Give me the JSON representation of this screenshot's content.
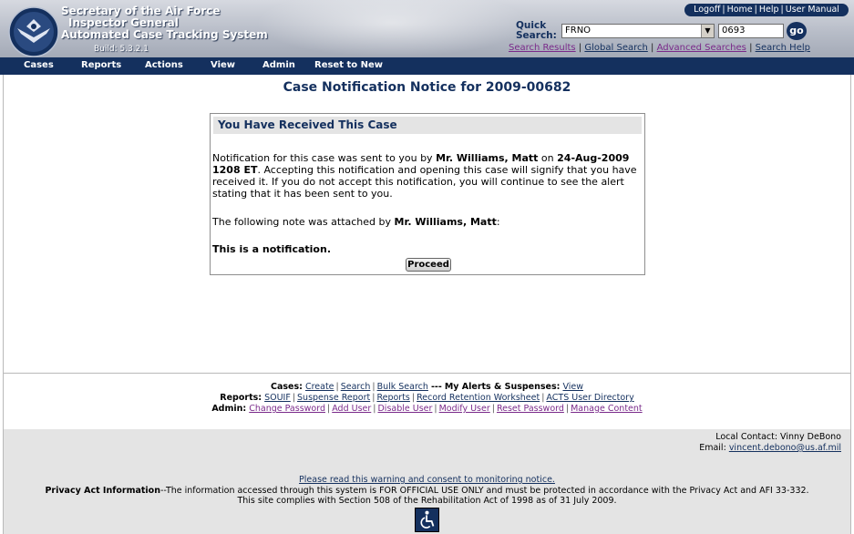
{
  "header": {
    "org_line1": "Secretary of the Air Force",
    "org_line2": "Inspector General",
    "org_line3": "Automated Case Tracking System",
    "build": "Build: 5.3.2.1",
    "top_links": [
      "Logoff",
      "Home",
      "Help",
      "User Manual"
    ],
    "quick_search": {
      "label_line1": "Quick",
      "label_line2": "Search:",
      "selected_type": "FRNO",
      "value": "0693",
      "go_label": "go"
    },
    "search_links": [
      "Search Results",
      "Global Search",
      "Advanced Searches",
      "Search Help"
    ]
  },
  "nav": [
    "Cases",
    "Reports",
    "Actions",
    "View",
    "Admin",
    "Reset to New"
  ],
  "page_title": "Case Notification Notice for 2009-00682",
  "notice": {
    "heading": "You Have Received This Case",
    "p1_prefix": "Notification for this case was sent to you by ",
    "sender": "Mr. Williams, Matt",
    "p1_on": " on ",
    "date": "24-Aug-2009 1208 ET",
    "p1_suffix": ". Accepting this notification and opening this case will signify that you have received it. If you do not accept this notification, you will continue to see the alert stating that it has been sent to you.",
    "note_prefix": "The following note was attached by ",
    "note_sender": "Mr. Williams, Matt",
    "note_suffix": ":",
    "note_text": "This is a notification.",
    "proceed_label": "Proceed"
  },
  "footer": {
    "cases_label": "Cases:",
    "cases_links": [
      "Create",
      "Search",
      "Bulk Search"
    ],
    "alerts_sep": "---",
    "alerts_label": "My Alerts & Suspenses:",
    "alerts_link": "View",
    "reports_label": "Reports:",
    "reports_links": [
      "SOUIF",
      "Suspense Report",
      "Reports",
      "Record Retention Worksheet",
      "ACTS User Directory"
    ],
    "admin_label": "Admin:",
    "admin_links": [
      "Change Password",
      "Add User",
      "Disable User",
      "Modify User",
      "Reset Password",
      "Manage Content"
    ]
  },
  "contact": {
    "local_contact": "Local Contact: Vinny DeBono",
    "email_label": "Email:",
    "email": "vincent.debono@us.af.mil"
  },
  "warning_link": "Please read this warning and consent to monitoring notice.",
  "privacy": {
    "label": "Privacy Act Information",
    "text": "--The information accessed through this system is FOR OFFICIAL USE ONLY and must be protected in accordance with the Privacy Act and AFI 33-332.",
    "section508": "This site complies with Section 508 of the Rehabilitation Act of 1998 as of 31 July 2009."
  },
  "colors": {
    "navy": "#14305e",
    "visited_link": "#7a2a8a",
    "panel_gray": "#e4e4e4"
  }
}
